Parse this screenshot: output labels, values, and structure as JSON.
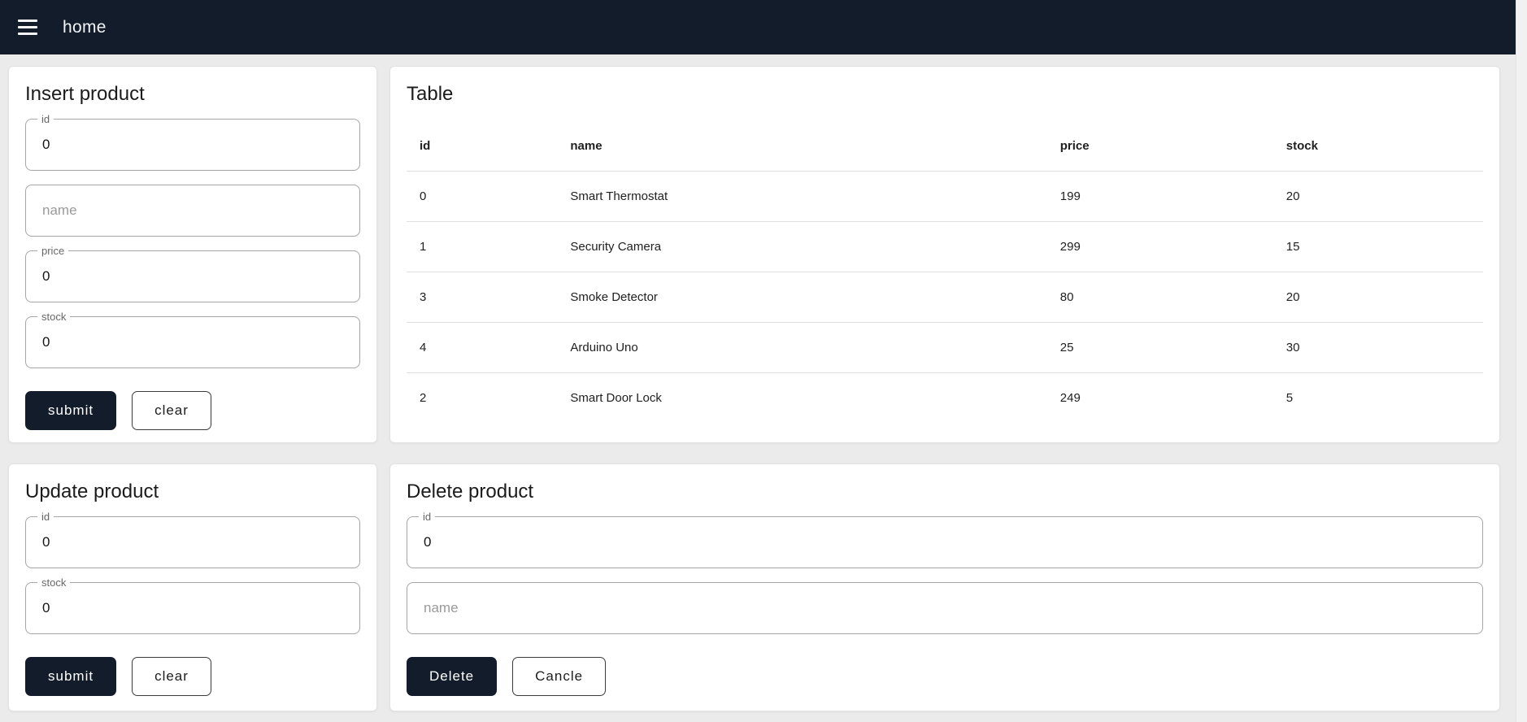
{
  "colors": {
    "primary": "#131c2b",
    "page_background": "#ebebeb",
    "card_background": "#ffffff",
    "card_border": "#e2e2e2",
    "field_border": "#a6a6a6",
    "divider": "#e0e0e0"
  },
  "header": {
    "title": "home",
    "menu_icon": "hamburger-icon"
  },
  "insert": {
    "title": "Insert product",
    "id_label": "id",
    "id_value": "0",
    "name_placeholder": "name",
    "price_label": "price",
    "price_value": "0",
    "stock_label": "stock",
    "stock_value": "0",
    "submit_label": "submit",
    "clear_label": "clear"
  },
  "table": {
    "title": "Table",
    "columns": [
      "id",
      "name",
      "price",
      "stock"
    ],
    "rows": [
      [
        "0",
        "Smart Thermostat",
        "199",
        "20"
      ],
      [
        "1",
        "Security Camera",
        "299",
        "15"
      ],
      [
        "3",
        "Smoke Detector",
        "80",
        "20"
      ],
      [
        "4",
        "Arduino Uno",
        "25",
        "30"
      ],
      [
        "2",
        "Smart Door Lock",
        "249",
        "5"
      ]
    ]
  },
  "update": {
    "title": "Update product",
    "id_label": "id",
    "id_value": "0",
    "stock_label": "stock",
    "stock_value": "0",
    "submit_label": "submit",
    "clear_label": "clear"
  },
  "delete": {
    "title": "Delete product",
    "id_label": "id",
    "id_value": "0",
    "name_placeholder": "name",
    "delete_label": "Delete",
    "cancel_label": "Cancle"
  }
}
